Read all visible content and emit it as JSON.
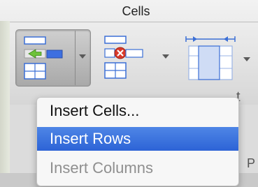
{
  "ribbon": {
    "group_title": "Cells",
    "buttons": [
      {
        "name": "insert",
        "icon": "insert-cells-icon",
        "active": true
      },
      {
        "name": "delete",
        "icon": "delete-cells-icon",
        "active": false
      },
      {
        "name": "format",
        "icon": "format-cells-icon",
        "active": false
      }
    ]
  },
  "menu": {
    "items": [
      {
        "label": "Insert Cells...",
        "state": "normal"
      },
      {
        "label": "Insert Rows",
        "state": "highlighted"
      },
      {
        "label": "Insert Columns",
        "state": "disabled"
      }
    ]
  },
  "colors": {
    "highlight": "#2d63d6",
    "icon_blue": "#3d6fe0",
    "delete_red": "#d93a2a"
  }
}
